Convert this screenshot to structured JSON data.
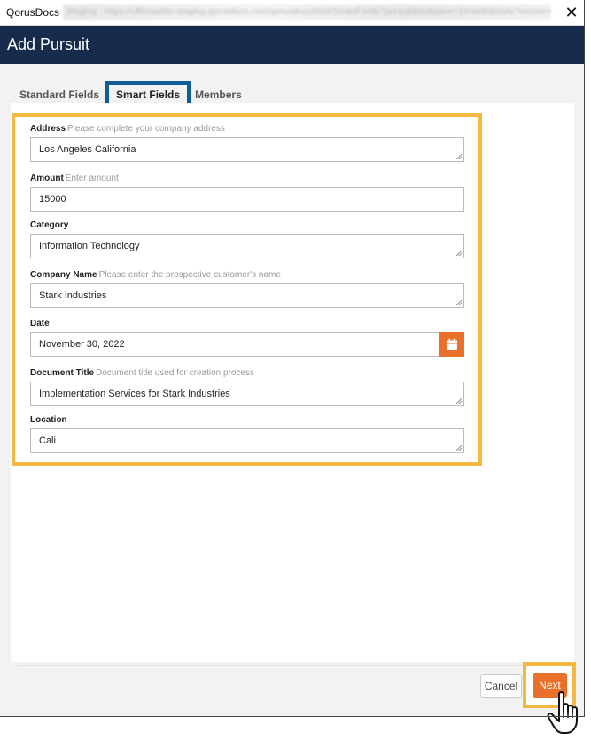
{
  "window": {
    "app_name": "QorusDocs",
    "url": "Staging · https://officeaddin-staging.qorusdocs.com/qorusdocs/html/SmartFields?pursuit&taskpane=1#/add/details?version=docs"
  },
  "dialog": {
    "title": "Add Pursuit"
  },
  "tabs": [
    {
      "label": "Standard Fields",
      "active": false
    },
    {
      "label": "Smart Fields",
      "active": true
    },
    {
      "label": "Members",
      "active": false
    }
  ],
  "fields": [
    {
      "label": "Address",
      "hint": "Please complete your company address",
      "value": "Los Angeles California"
    },
    {
      "label": "Amount",
      "hint": "Enter amount",
      "value": "15000"
    },
    {
      "label": "Category",
      "hint": "",
      "value": "Information Technology"
    },
    {
      "label": "Company Name",
      "hint": "Please enter the prospective customer's name",
      "value": "Stark Industries"
    },
    {
      "label": "Date",
      "hint": "",
      "value": "November 30, 2022"
    },
    {
      "label": "Document Title",
      "hint": "Document title used for creation process",
      "value": "Implementation Services for Stark Industries"
    },
    {
      "label": "Location",
      "hint": "",
      "value": "Cali"
    }
  ],
  "footer": {
    "cancel_label": "Cancel",
    "next_label": "Next"
  },
  "colors": {
    "header": "#172b4d",
    "accent": "#e8702a",
    "highlight": "#f4b740",
    "tab_highlight": "#0f5c96"
  }
}
